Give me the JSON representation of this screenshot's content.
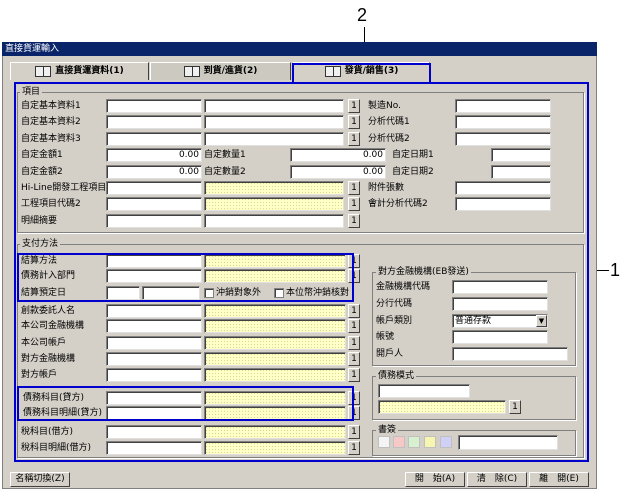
{
  "window": {
    "title": "直接貨運輸入"
  },
  "callouts": {
    "one": "1",
    "two": "2"
  },
  "tabs": [
    {
      "label": "直接貨運資料(1)"
    },
    {
      "label": "到貨/進貨(2)"
    },
    {
      "label": "發貨/銷售(3)"
    }
  ],
  "sections": {
    "items": "項目",
    "payment": "支付方法",
    "counterparty_bank": "對方金融機構(EB發送)",
    "debt_mode": "債務模式",
    "seal": "書簽"
  },
  "items_rows": [
    {
      "label": "自定基本資料1"
    },
    {
      "label": "自定基本資料2"
    },
    {
      "label": "自定基本資料3"
    },
    {
      "label": "自定金額1",
      "value": "0.00",
      "label2": "自定數量1",
      "value2": "0.00",
      "label3": "自定日期1"
    },
    {
      "label": "自定金額2",
      "value": "0.00",
      "label2": "自定數量2",
      "value2": "0.00",
      "label3": "自定日期2"
    },
    {
      "label": "Hi-Line開發工程項目"
    },
    {
      "label": "工程項目代碼2"
    },
    {
      "label": "明細摘要"
    }
  ],
  "right_items": [
    {
      "label": "製造No."
    },
    {
      "label": "分析代碼1"
    },
    {
      "label": "分析代碼2"
    },
    {
      "label": "附件張數"
    },
    {
      "label": "會計分析代碼2"
    }
  ],
  "payment_rows": [
    {
      "label": "結算方法"
    },
    {
      "label": "債務計入部門"
    },
    {
      "label": "結算預定日",
      "chk1": "沖銷對象外",
      "chk2": "本位幣沖銷核對"
    },
    {
      "label": "創款委託人名"
    },
    {
      "label": "本公司金融機構"
    },
    {
      "label": "本公司帳戶"
    },
    {
      "label": "對方金融機構"
    },
    {
      "label": "對方帳戶"
    },
    {
      "label": "債務科目(貸方)"
    },
    {
      "label": "債務科目明細(貸方)"
    },
    {
      "label": "稅科目(借方)"
    },
    {
      "label": "稅科目明細(借方)"
    }
  ],
  "bank_rows": [
    {
      "label": "金融機構代碼"
    },
    {
      "label": "分行代碼"
    },
    {
      "label": "帳戶類別",
      "value": "普通存款"
    },
    {
      "label": "帳號"
    },
    {
      "label": "開戶人"
    }
  ],
  "small_button": "1",
  "bottom": {
    "switch": "名稱切換(Z)",
    "start": "開　始(A)",
    "clear": "清　除(C)",
    "close": "離　開(E)"
  },
  "colors": {
    "callout_box": "#0000cc",
    "title_bar": "#0a246a",
    "face": "#d4d0c8",
    "pickfield": "#ffffc8"
  }
}
